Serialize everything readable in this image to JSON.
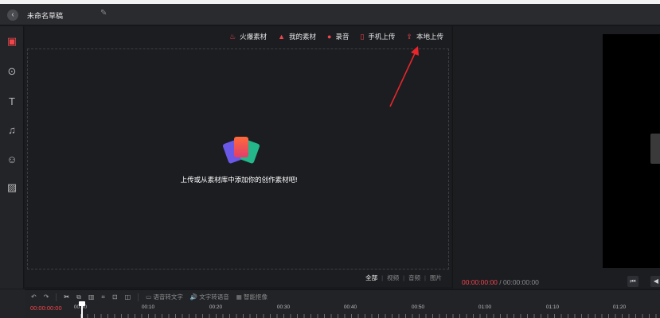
{
  "header": {
    "title": "未命名草稿",
    "back_icon": "back-arrow-icon",
    "edit_icon": "pencil-icon"
  },
  "sidebar": {
    "items": [
      {
        "name": "media",
        "icon": "film-icon",
        "glyph": "▣",
        "active": true
      },
      {
        "name": "effects",
        "icon": "filter-icon",
        "glyph": "⊙",
        "active": false
      },
      {
        "name": "text",
        "icon": "text-icon",
        "glyph": "T",
        "active": false
      },
      {
        "name": "audio",
        "icon": "music-note-icon",
        "glyph": "♫",
        "active": false
      },
      {
        "name": "sticker",
        "icon": "smile-icon",
        "glyph": "☺",
        "active": false
      },
      {
        "name": "transition",
        "icon": "image-icon",
        "glyph": "▨",
        "active": false
      }
    ]
  },
  "tabs": [
    {
      "label": "火爆素材",
      "icon": "flame-icon",
      "glyph": "♨"
    },
    {
      "label": "我的素材",
      "icon": "triangle-icon",
      "glyph": "▲"
    },
    {
      "label": "录音",
      "icon": "mic-icon",
      "glyph": "🎙"
    },
    {
      "label": "手机上传",
      "icon": "phone-icon",
      "glyph": "▯"
    },
    {
      "label": "本地上传",
      "icon": "upload-icon",
      "glyph": "⇪"
    }
  ],
  "dropzone": {
    "text": "上传或从素材库中添加你的创作素材吧!"
  },
  "filters": {
    "all": "全部",
    "video": "视频",
    "audio": "音频",
    "image": "图片",
    "sep": "|"
  },
  "preview": {
    "current_time": "00:00:00:00",
    "total_time": "/ 00:00:00:00"
  },
  "timeline": {
    "tools": {
      "undo": "↶",
      "redo": "↷",
      "cut": "✂",
      "copy": "⧉",
      "delete": "🗑",
      "crop": "⌗",
      "freeze": "⊡",
      "split": "◫",
      "speech_to_text": "语音转文字",
      "text_to_speech": "文字转语音",
      "smart_cutout": "智能抠像"
    },
    "current_time": "00:00:00:00",
    "ticks": [
      "00:00",
      "00:10",
      "00:20",
      "00:30",
      "00:40",
      "00:50",
      "01:00",
      "01:10",
      "01:20"
    ]
  },
  "colors": {
    "accent": "#f0464b",
    "background": "#18191c",
    "panel": "#1c1d21"
  }
}
